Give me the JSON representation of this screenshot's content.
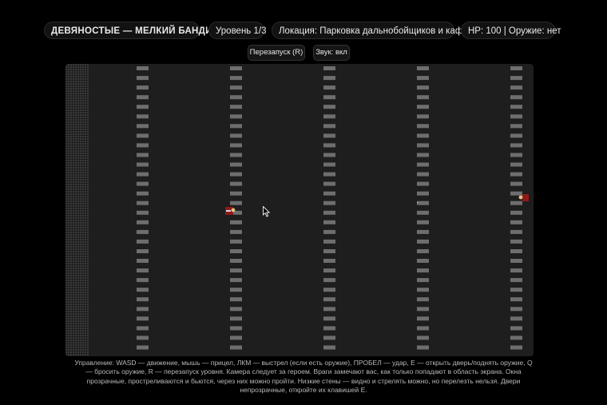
{
  "hud": {
    "title": "ДЕВЯНОСТЫЕ — МЕЛКИЙ БАНДИТ",
    "level": "Уровень 1/3",
    "location": "Локация: Парковка дальнобойщиков и кафе",
    "status": "HP: 100 | Оружие: нет"
  },
  "buttons": {
    "restart": "Перезапуск (R)",
    "sound": "Звук: вкл"
  },
  "game": {
    "player": {
      "hp": 100,
      "weapon": "нет"
    },
    "level_current": 1,
    "level_total": 3,
    "colors": {
      "background": "#000000",
      "arena": "#1e1e1e",
      "sidebar_pattern": "#3a3a3a",
      "lane_marking": "#6e6e6e",
      "enemy": "#8e1a1a",
      "player_head": "#e3c486"
    }
  },
  "help_text": "Управление: WASD — движение, мышь — прицел, ЛКМ — выстрел (если есть оружие), ПРОБЕЛ — удар, E — открыть дверь/поднять оружие, Q — бросить оружие, R — перезапуск уровня. Камера следует за героем. Враги замечают вас, как только попадают в область экрана. Окна прозрачные, простреливаются и бьются, через них можно пройти. Низкие стены — видно и стрелять можно, но перелезть нельзя. Двери непрозрачные, откройте их клавишей E."
}
